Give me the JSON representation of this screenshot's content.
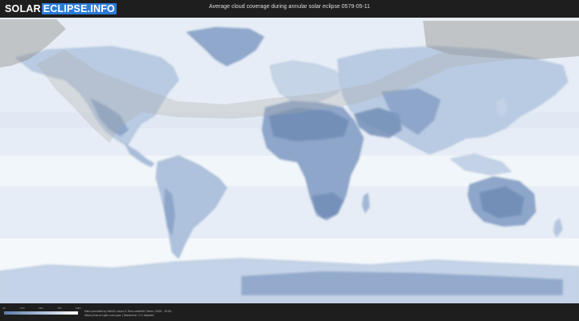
{
  "header": {
    "logo_part1": "SOLAR",
    "logo_part2": "ECLIPSE.INFO",
    "title": "Average cloud coverage during annular solar eclipse 0579-05-11"
  },
  "legend": {
    "ticks": [
      "0%",
      "25%",
      "50%",
      "75%",
      "100%"
    ],
    "colors": {
      "low": "#5c7ca8",
      "mid": "#a9bdd9",
      "high": "#ffffff"
    }
  },
  "credits": {
    "line1": "Data provided by NASA's Aqua & Terra satellite (Years: 2000 - 2019)",
    "line2": "https://neo.sci.gsfc.nasa.gov | Resolution: 0.1 degrees"
  },
  "map_colors": {
    "ocean": "#e6edf6",
    "land_clear": "#7f99c1",
    "land_cloudy": "#cfdbea",
    "eclipse_shadow": "#8c8c88"
  }
}
